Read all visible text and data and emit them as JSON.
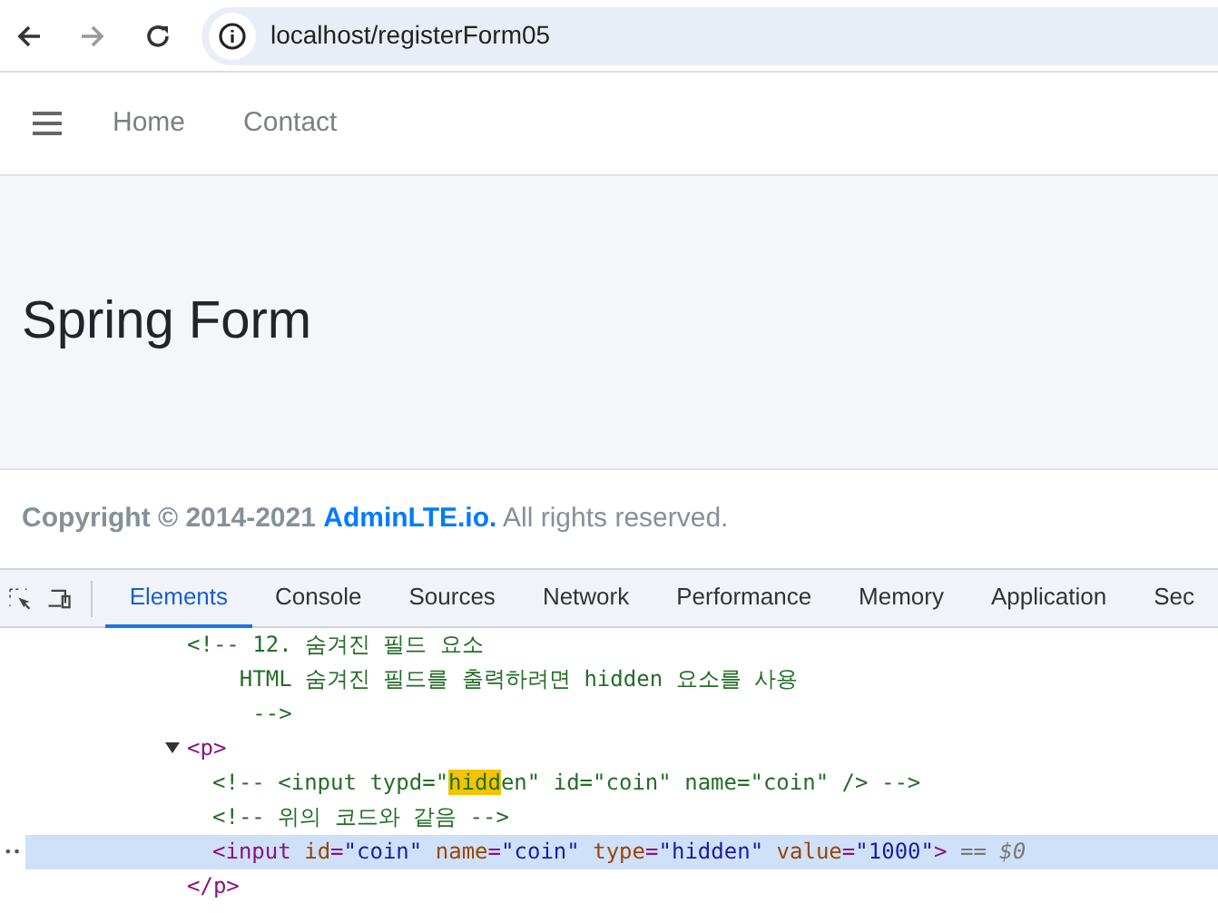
{
  "browser": {
    "url": "localhost/registerForm05"
  },
  "navbar": {
    "links": [
      "Home",
      "Contact"
    ]
  },
  "content": {
    "title": "Spring Form"
  },
  "footer": {
    "copyright": "Copyright © 2014-2021",
    "brand": "AdminLTE.io.",
    "rights": "All rights reserved."
  },
  "devtools": {
    "tabs": [
      {
        "label": "Elements",
        "selected": true
      },
      {
        "label": "Console",
        "selected": false
      },
      {
        "label": "Sources",
        "selected": false
      },
      {
        "label": "Network",
        "selected": false
      },
      {
        "label": "Performance",
        "selected": false
      },
      {
        "label": "Memory",
        "selected": false
      },
      {
        "label": "Application",
        "selected": false
      },
      {
        "label": "Sec",
        "selected": false
      }
    ],
    "nodes": [
      {
        "kind": "comment",
        "lines": [
          "<!-- 12. 숨겨진 필드 요소",
          "    HTML 숨겨진 필드를 출력하려면 hidden 요소를 사용",
          "     -->"
        ]
      },
      {
        "kind": "element",
        "open_tag": "<p>",
        "close_tag": "</p>",
        "expanded": true,
        "children": [
          {
            "kind": "comment",
            "segments": [
              {
                "text": "<!-- <input typd=\"",
                "highlighted": false
              },
              {
                "text": "hidd",
                "highlighted": true
              },
              {
                "text": "en\" id=\"coin\" name=\"coin\" /> -->",
                "highlighted": false
              }
            ]
          },
          {
            "kind": "comment",
            "lines": [
              "<!-- 위의 코드와 같음 -->"
            ]
          },
          {
            "kind": "tag",
            "selected": true,
            "gutter_mark": "••",
            "tag": "<input",
            "attrs": [
              {
                "name": "id",
                "eq": "=",
                "value": "\"coin\""
              },
              {
                "name": "name",
                "eq": "=",
                "value": "\"coin\""
              },
              {
                "name": "type",
                "eq": "=",
                "value": "\"hidden\""
              },
              {
                "name": "value",
                "eq": "=",
                "value": "\"1000\""
              }
            ],
            "end": ">",
            "suffix": "== $0"
          }
        ]
      }
    ]
  }
}
